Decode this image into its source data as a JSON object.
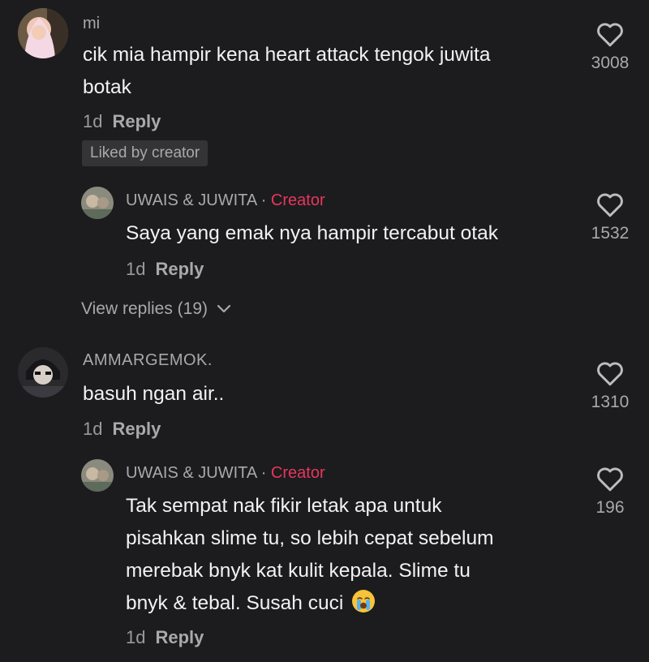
{
  "comments": [
    {
      "username": "mi",
      "text_lines": [
        "cik mia hampir kena heart attack tengok juwita",
        "botak"
      ],
      "age": "1d",
      "reply_label": "Reply",
      "badge": "Liked by creator",
      "likes": "3008",
      "replies": [
        {
          "username": "UWAIS & JUWITA",
          "separator": "·",
          "role": "Creator",
          "text_lines": [
            "Saya yang emak nya hampir tercabut otak"
          ],
          "age": "1d",
          "reply_label": "Reply",
          "likes": "1532"
        }
      ],
      "view_replies": "View replies (19)"
    },
    {
      "username": "AMMARGEMOK.",
      "text_lines": [
        "basuh ngan air.."
      ],
      "age": "1d",
      "reply_label": "Reply",
      "likes": "1310",
      "replies": [
        {
          "username": "UWAIS & JUWITA",
          "separator": "·",
          "role": "Creator",
          "text_lines": [
            "Tak sempat nak fikir letak apa untuk",
            "pisahkan slime tu, so lebih cepat sebelum",
            "merebak bnyk kat kulit kepala. Slime tu",
            "bnyk & tebal. Susah cuci"
          ],
          "emoji": "crying-face",
          "age": "1d",
          "reply_label": "Reply",
          "likes": "196"
        }
      ]
    }
  ],
  "colors": {
    "background": "#1c1c1e",
    "creator": "#e8365b",
    "muted": "#a9a9ab"
  }
}
